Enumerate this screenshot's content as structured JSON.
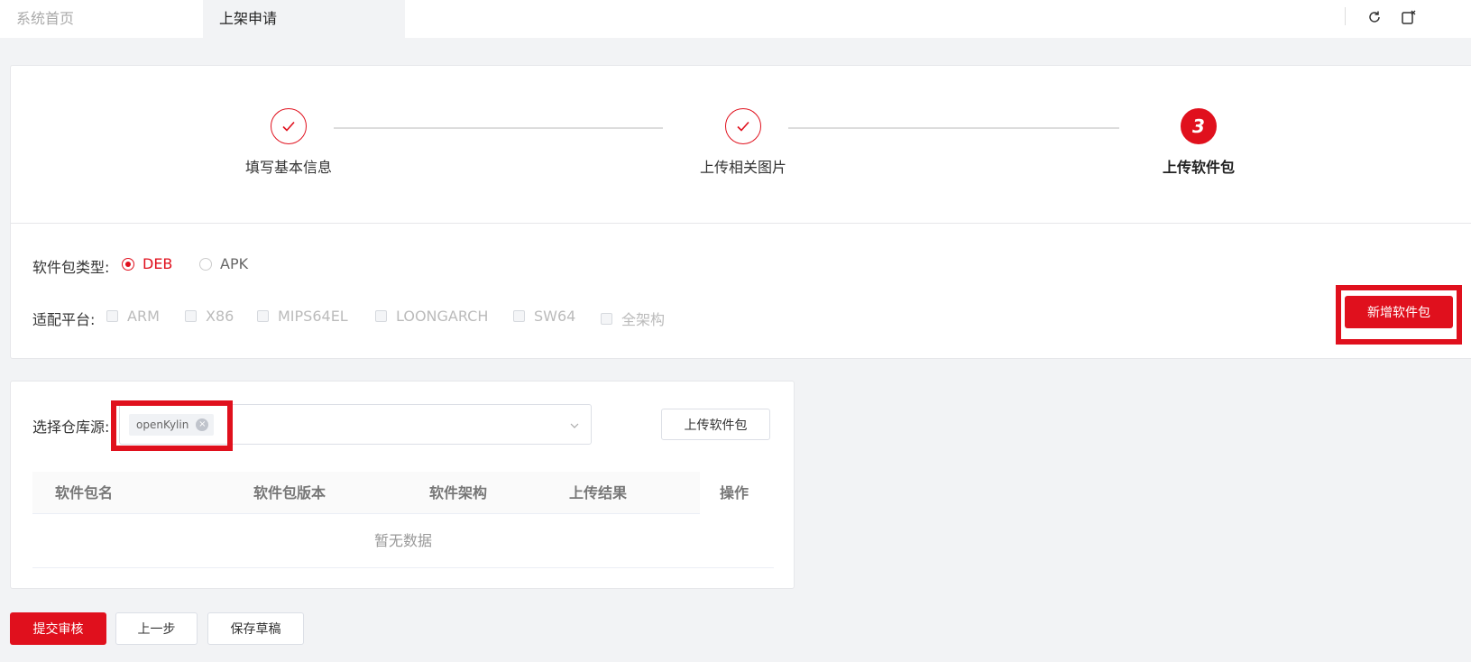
{
  "tabs": [
    {
      "label": "系统首页"
    },
    {
      "label": "上架申请"
    }
  ],
  "toolbar": {
    "refresh_icon": "refresh-icon",
    "close_icon": "close-tab-icon"
  },
  "steps": [
    {
      "label": "填写基本信息",
      "status": "done"
    },
    {
      "label": "上传相关图片",
      "status": "done"
    },
    {
      "label": "上传软件包",
      "status": "active",
      "number": "3"
    }
  ],
  "package_type": {
    "label": "软件包类型:",
    "options": [
      {
        "label": "DEB",
        "checked": true
      },
      {
        "label": "APK",
        "checked": false
      }
    ]
  },
  "platform": {
    "label": "适配平台:",
    "options": [
      {
        "label": "ARM"
      },
      {
        "label": "X86"
      },
      {
        "label": "MIPS64EL"
      },
      {
        "label": "LOONGARCH"
      },
      {
        "label": "SW64"
      },
      {
        "label": "全架构"
      }
    ]
  },
  "add_package_button": "新增软件包",
  "repo": {
    "label": "选择仓库源:",
    "selected_tag": "openKylin",
    "upload_button": "上传软件包"
  },
  "table": {
    "headers": [
      "软件包名",
      "软件包版本",
      "软件架构",
      "上传结果",
      "操作"
    ],
    "empty_text": "暂无数据"
  },
  "footer": {
    "submit": "提交审核",
    "prev": "上一步",
    "save_draft": "保存草稿"
  },
  "colors": {
    "accent": "#e0101d"
  }
}
